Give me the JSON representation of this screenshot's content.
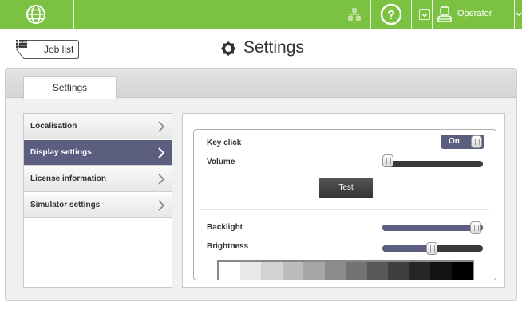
{
  "topbar": {
    "operator_label": "Operator",
    "icons": [
      "globe-icon",
      "network-icon",
      "help-icon",
      "user-icon",
      "chevron-down-icon"
    ]
  },
  "header": {
    "back_label": "Job list",
    "title": "Settings"
  },
  "tabs": [
    {
      "label": "Settings",
      "active": true
    }
  ],
  "menu": {
    "items": [
      {
        "label": "Localisation",
        "active": false
      },
      {
        "label": "Display settings",
        "active": true
      },
      {
        "label": "License information",
        "active": false
      },
      {
        "label": "Simulator settings",
        "active": false
      }
    ]
  },
  "settings": {
    "key_click": {
      "label": "Key click",
      "value": "On"
    },
    "volume": {
      "label": "Volume",
      "level": 0.0
    },
    "test_label": "Test",
    "backlight": {
      "label": "Backlight",
      "level": 1.0
    },
    "brightness": {
      "label": "Brightness",
      "level": 0.5
    }
  },
  "gray_strip": [
    "#ffffff",
    "#e8e8e8",
    "#d2d2d2",
    "#bcbcbc",
    "#a6a6a6",
    "#8c8c8c",
    "#727272",
    "#585858",
    "#3e3e3e",
    "#262626",
    "#121212",
    "#000000"
  ],
  "colors": {
    "topbar": "#7cc242",
    "accent": "#5c5e80"
  }
}
